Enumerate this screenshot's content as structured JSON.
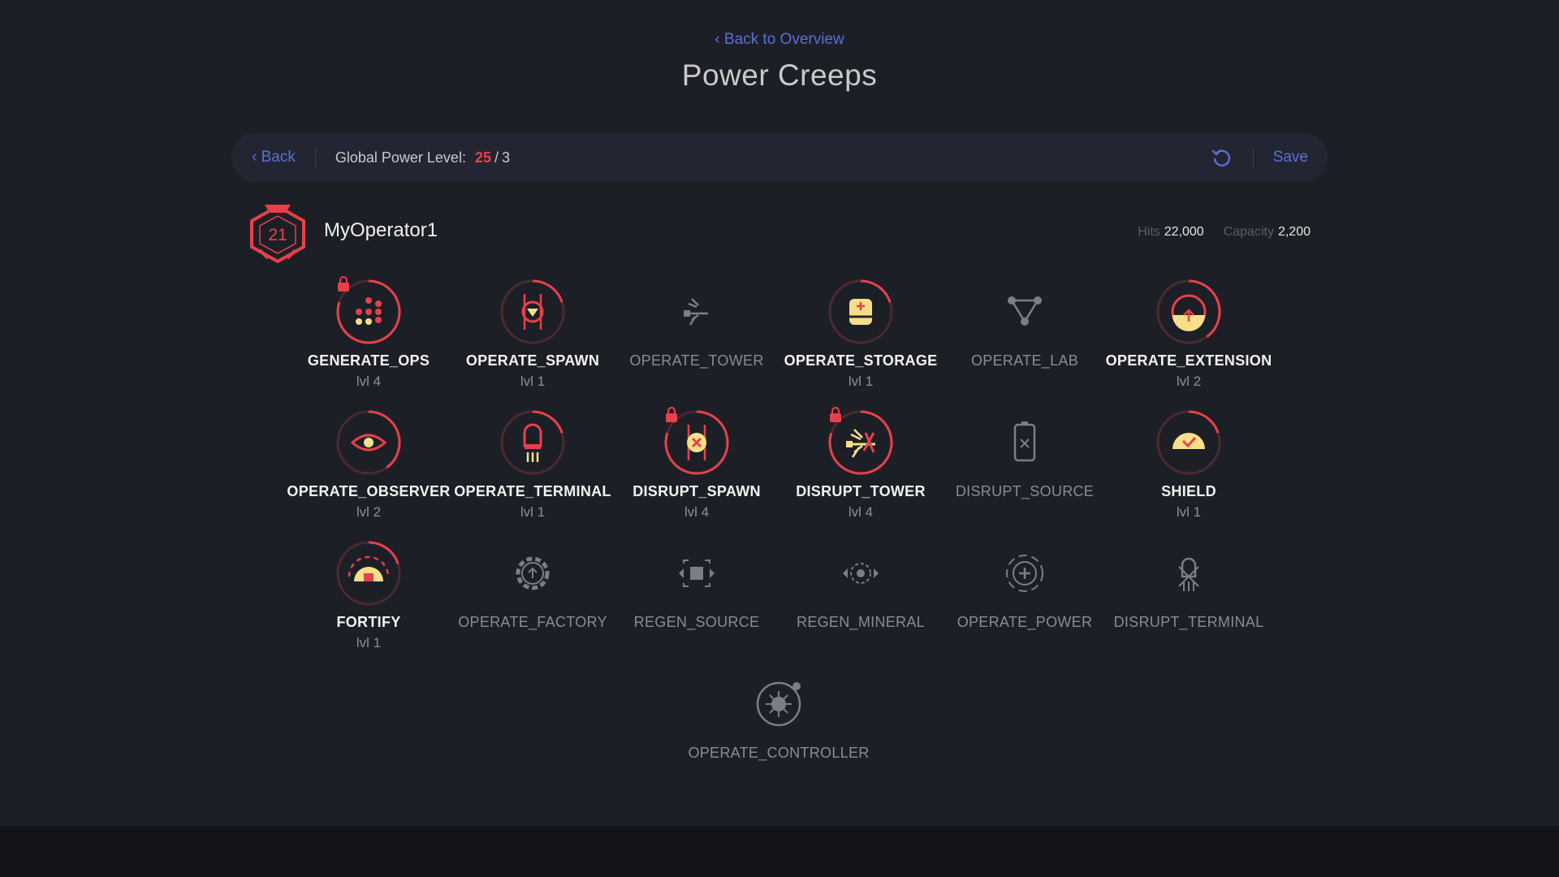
{
  "header": {
    "back_to_overview": "Back to Overview",
    "title": "Power Creeps"
  },
  "toolbar": {
    "back_label": "Back",
    "global_power_label": "Global Power Level:",
    "global_power_current": "25",
    "global_power_slash": "/",
    "global_power_total": "3",
    "save_label": "Save",
    "undo_icon": "undo-icon"
  },
  "operator": {
    "level": "21",
    "name": "MyOperator1",
    "hits_label": "Hits",
    "hits_value": "22,000",
    "capacity_label": "Capacity",
    "capacity_value": "2,200",
    "badge_icon": "operator-badge-icon"
  },
  "colors": {
    "accent_red": "#e8404a",
    "link_blue": "#5c6fd6",
    "icon_yellow": "#f5e08a",
    "ring_dark": "#4a2a30",
    "disabled_gray": "#7c7e85",
    "background": "#1d1f27"
  },
  "skills": [
    {
      "name": "GENERATE_OPS",
      "level": "lvl 4",
      "active": true,
      "locked": true,
      "progress": 0.8,
      "icon": "generate-ops-icon"
    },
    {
      "name": "OPERATE_SPAWN",
      "level": "lvl 1",
      "active": true,
      "locked": false,
      "progress": 0.2,
      "icon": "operate-spawn-icon"
    },
    {
      "name": "OPERATE_TOWER",
      "level": "",
      "active": false,
      "locked": false,
      "progress": 0,
      "icon": "operate-tower-icon"
    },
    {
      "name": "OPERATE_STORAGE",
      "level": "lvl 1",
      "active": true,
      "locked": false,
      "progress": 0.2,
      "icon": "operate-storage-icon"
    },
    {
      "name": "OPERATE_LAB",
      "level": "",
      "active": false,
      "locked": false,
      "progress": 0,
      "icon": "operate-lab-icon"
    },
    {
      "name": "OPERATE_EXTENSION",
      "level": "lvl 2",
      "active": true,
      "locked": false,
      "progress": 0.4,
      "icon": "operate-extension-icon"
    },
    {
      "name": "OPERATE_OBSERVER",
      "level": "lvl 2",
      "active": true,
      "locked": false,
      "progress": 0.4,
      "icon": "operate-observer-icon"
    },
    {
      "name": "OPERATE_TERMINAL",
      "level": "lvl 1",
      "active": true,
      "locked": false,
      "progress": 0.2,
      "icon": "operate-terminal-icon"
    },
    {
      "name": "DISRUPT_SPAWN",
      "level": "lvl 4",
      "active": true,
      "locked": true,
      "progress": 0.8,
      "icon": "disrupt-spawn-icon"
    },
    {
      "name": "DISRUPT_TOWER",
      "level": "lvl 4",
      "active": true,
      "locked": true,
      "progress": 0.8,
      "icon": "disrupt-tower-icon"
    },
    {
      "name": "DISRUPT_SOURCE",
      "level": "",
      "active": false,
      "locked": false,
      "progress": 0,
      "icon": "disrupt-source-icon"
    },
    {
      "name": "SHIELD",
      "level": "lvl 1",
      "active": true,
      "locked": false,
      "progress": 0.2,
      "icon": "shield-icon"
    },
    {
      "name": "FORTIFY",
      "level": "lvl 1",
      "active": true,
      "locked": false,
      "progress": 0.2,
      "icon": "fortify-icon"
    },
    {
      "name": "OPERATE_FACTORY",
      "level": "",
      "active": false,
      "locked": false,
      "progress": 0,
      "icon": "operate-factory-icon"
    },
    {
      "name": "REGEN_SOURCE",
      "level": "",
      "active": false,
      "locked": false,
      "progress": 0,
      "icon": "regen-source-icon"
    },
    {
      "name": "REGEN_MINERAL",
      "level": "",
      "active": false,
      "locked": false,
      "progress": 0,
      "icon": "regen-mineral-icon"
    },
    {
      "name": "OPERATE_POWER",
      "level": "",
      "active": false,
      "locked": false,
      "progress": 0,
      "icon": "operate-power-icon"
    },
    {
      "name": "DISRUPT_TERMINAL",
      "level": "",
      "active": false,
      "locked": false,
      "progress": 0,
      "icon": "disrupt-terminal-icon"
    },
    {
      "name": "OPERATE_CONTROLLER",
      "level": "",
      "active": false,
      "locked": false,
      "progress": 0,
      "icon": "operate-controller-icon"
    }
  ]
}
